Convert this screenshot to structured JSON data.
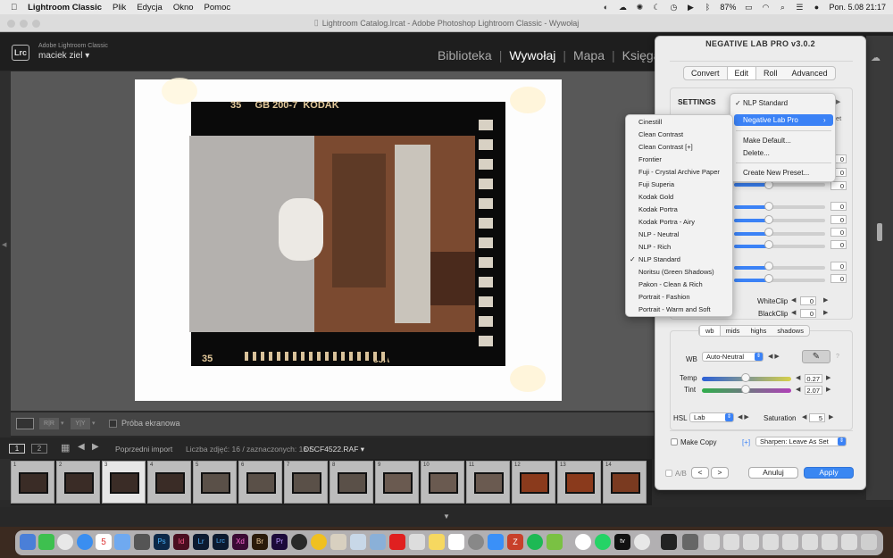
{
  "menubar": {
    "app": "Lightroom Classic",
    "items": [
      "Plik",
      "Edycja",
      "Okno",
      "Pomoc"
    ],
    "battery": "87%",
    "clock": "Pon. 5.08  21:17"
  },
  "window": {
    "title": "Lightroom Catalog.lrcat - Adobe Photoshop Lightroom Classic - Wywołaj"
  },
  "header": {
    "logo": "Lrc",
    "product": "Adobe Lightroom Classic",
    "user": "maciek ziel",
    "modules": [
      "Biblioteka",
      "Wywołaj",
      "Mapa",
      "Księga"
    ],
    "active_module": "Wywołaj"
  },
  "toolbar": {
    "soft_proof": "Próba ekranowa",
    "ba_left": "R|R",
    "ba_right": "Y|Y"
  },
  "filmstrip_bar": {
    "page1": "1",
    "page2": "2",
    "source": "Poprzedni import",
    "count": "Liczba zdjęć: 16 / zaznaczonych: 16 /",
    "file": "DSCF4522.RAF"
  },
  "thumbs": [
    "1",
    "2",
    "3",
    "4",
    "5",
    "6",
    "7",
    "8",
    "9",
    "10",
    "11",
    "12",
    "13",
    "14"
  ],
  "film_text": {
    "top": "35     GB 200-7  KODAK",
    "bottom_left": "35",
    "bottom_right": "35A"
  },
  "nlp": {
    "title": "NEGATIVE LAB PRO v3.0.2",
    "tabs": [
      "Convert",
      "Edit",
      "Roll",
      "Advanced"
    ],
    "active_tab": "Edit",
    "settings_label": "SETTINGS",
    "values": [
      "0",
      "0",
      "0",
      "0",
      "0",
      "0",
      "0",
      "0",
      "0"
    ],
    "whiteclip_label": "WhiteClip",
    "whiteclip": "0",
    "blackclip_label": "BlackClip",
    "blackclip": "0",
    "tone_tabs": [
      "wb",
      "mids",
      "highs",
      "shadows"
    ],
    "wb_label": "WB",
    "wb_value": "Auto-Neutral",
    "temp_label": "Temp",
    "temp_value": "0.27",
    "tint_label": "Tint",
    "tint_value": "2.07",
    "hsl_label": "HSL",
    "hsl_value": "Lab",
    "saturation_label": "Saturation",
    "saturation_value": "5",
    "make_copy": "Make Copy",
    "plus": "[+]",
    "sharpen": "Sharpen: Leave As Set",
    "ab": "A/B",
    "prev": "<",
    "next": ">",
    "cancel": "Anuluj",
    "apply": "Apply",
    "colors": {
      "accent": "#3b82f6",
      "apply": "#3a87f2"
    }
  },
  "preset_menu": {
    "items": [
      "NLP Standard",
      "Negative Lab Pro",
      "Make Default...",
      "Delete...",
      "Create New Preset..."
    ],
    "checked": "NLP Standard",
    "highlighted": "Negative Lab Pro"
  },
  "submenu": {
    "items": [
      "Cinestill",
      "Clean Contrast",
      "Clean Contrast [+]",
      "Frontier",
      "Fuji - Crystal Archive Paper",
      "Fuji Superia",
      "Kodak Gold",
      "Kodak Portra",
      "Kodak Portra - Airy",
      "NLP - Neutral",
      "NLP - Rich",
      "NLP Standard",
      "Noritsu (Green Shadows)",
      "Pakon - Clean & Rich",
      "Portrait - Fashion",
      "Portrait - Warm and Soft"
    ],
    "checked": "NLP Standard"
  },
  "dock": {
    "calendar_day": "5"
  }
}
